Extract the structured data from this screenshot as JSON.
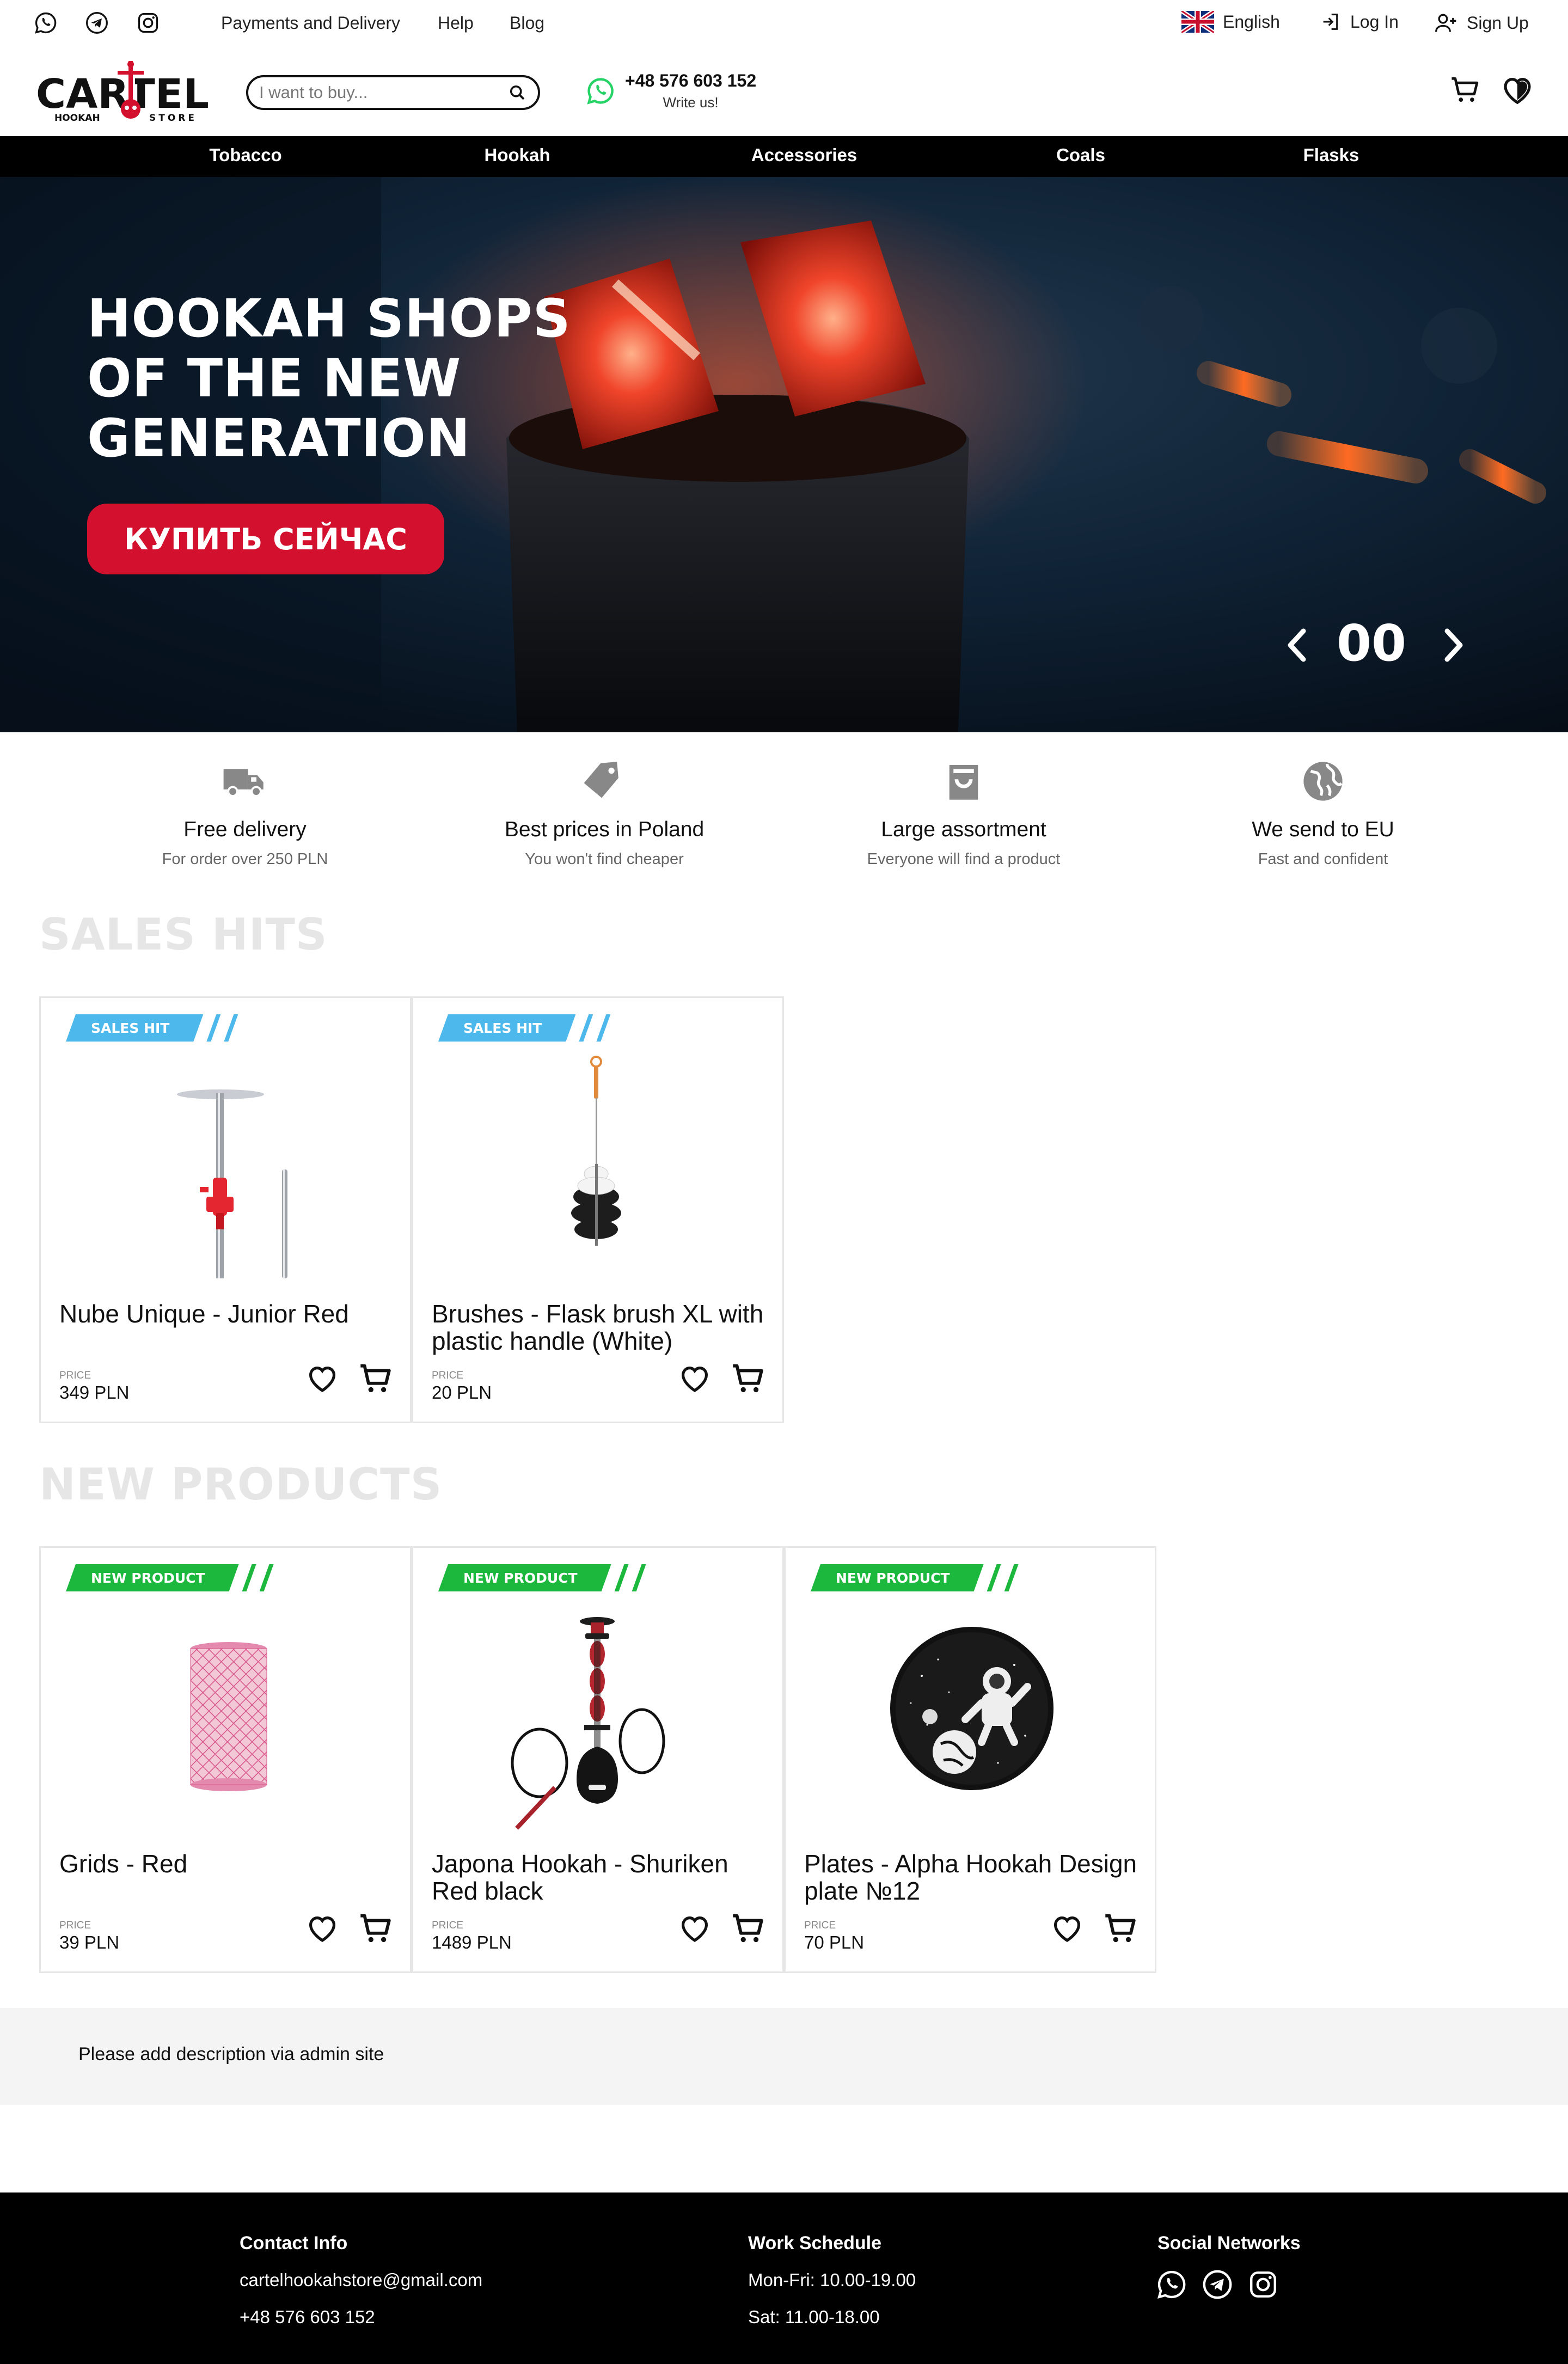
{
  "topbar": {
    "social_icons": [
      "whatsapp-icon",
      "telegram-icon",
      "instagram-icon"
    ],
    "links": [
      "Payments and Delivery",
      "Help",
      "Blog"
    ],
    "language": "English",
    "login": "Log In",
    "signup": "Sign Up"
  },
  "header": {
    "logo_text": "CARTEL",
    "logo_left": "HOOKAH",
    "logo_right": "STORE",
    "search_placeholder": "I want to buy...",
    "phone": "+48 576 603 152",
    "phone_sub": "Write us!"
  },
  "nav": [
    "Tobacco",
    "Hookah",
    "Accessories",
    "Coals",
    "Flasks"
  ],
  "hero": {
    "title_lines": [
      "HOOKAH SHOPS",
      "OF THE NEW",
      "GENERATION"
    ],
    "button": "КУПИТЬ СЕЙЧАС",
    "counter": "00"
  },
  "features": [
    {
      "icon": "truck-icon",
      "title": "Free delivery",
      "sub": "For order over 250 PLN"
    },
    {
      "icon": "price-tag-icon",
      "title": "Best prices in Poland",
      "sub": "You won't find cheaper"
    },
    {
      "icon": "shopping-bag-icon",
      "title": "Large assortment",
      "sub": "Everyone will find a product"
    },
    {
      "icon": "globe-icon",
      "title": "We send to EU",
      "sub": "Fast and confident"
    }
  ],
  "sales_hits": {
    "title": "SALES HITS",
    "badge": "SALES HIT",
    "badge_color": "#4cb8ec",
    "items": [
      {
        "name": "Nube Unique - Junior Red",
        "price_label": "PRICE",
        "price": "349 PLN",
        "image": "hookah-shaft-image"
      },
      {
        "name": "Brushes - Flask brush XL with plastic handle (White)",
        "price_label": "PRICE",
        "price": "20 PLN",
        "image": "flask-brush-image"
      }
    ]
  },
  "new_products": {
    "title": "NEW PRODUCTS",
    "badge": "NEW PRODUCT",
    "badge_color": "#1cb83d",
    "items": [
      {
        "name": "Grids - Red",
        "price_label": "PRICE",
        "price": "39 PLN",
        "image": "mesh-grid-image"
      },
      {
        "name": "Japona Hookah - Shuriken Red black",
        "price_label": "PRICE",
        "price": "1489 PLN",
        "image": "hookah-image"
      },
      {
        "name": "Plates - Alpha Hookah Design plate №12",
        "price_label": "PRICE",
        "price": "70 PLN",
        "image": "astronaut-plate-image"
      }
    ]
  },
  "description": "Please add description via admin site",
  "footer": {
    "contact_title": "Contact Info",
    "email": "cartelhookahstore@gmail.com",
    "phone": "+48 576 603 152",
    "schedule_title": "Work Schedule",
    "weekdays": "Mon-Fri: 10.00-19.00",
    "saturday": "Sat: 11.00-18.00",
    "social_title": "Social Networks",
    "social_icons": [
      "whatsapp-icon",
      "telegram-icon",
      "instagram-icon"
    ]
  },
  "colors": {
    "brand_red": "#d3102d",
    "nav_bg": "#000000",
    "footer_bg": "#000000",
    "section_title": "#e6e6e6"
  }
}
